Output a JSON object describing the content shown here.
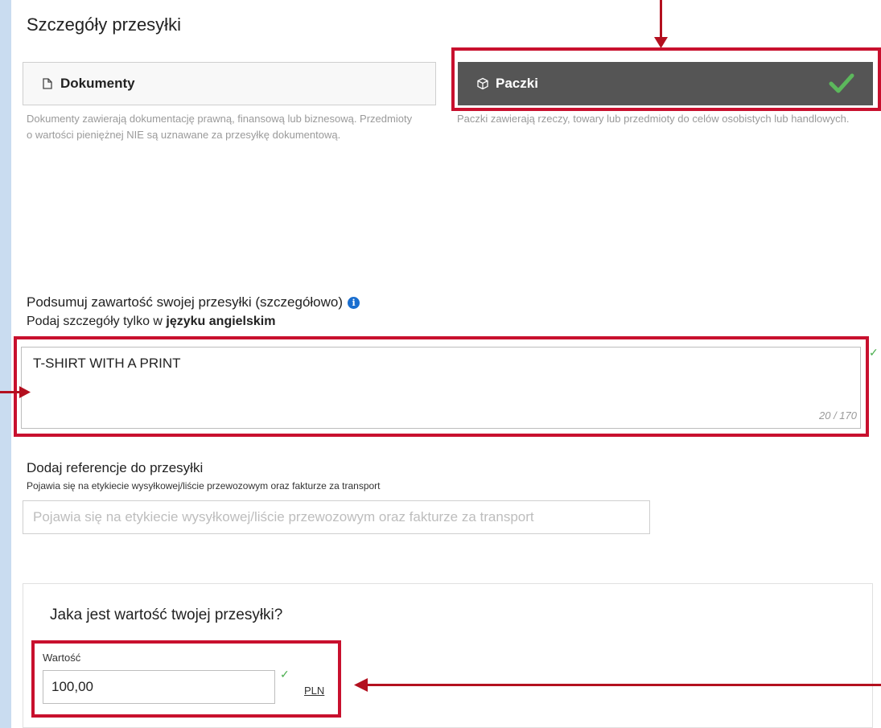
{
  "section": {
    "title": "Szczegóły przesyłki"
  },
  "options": {
    "documents": {
      "label": "Dokumenty",
      "icon": "document-icon",
      "description": "Dokumenty zawierają dokumentację prawną, finansową lub biznesową. Przedmioty o wartości pieniężnej NIE są uznawane za przesyłkę dokumentową."
    },
    "packages": {
      "label": "Paczki",
      "icon": "box-icon",
      "selected": true,
      "description": "Paczki zawierają rzeczy, towary lub przedmioty do celów osobistych lub handlowych."
    }
  },
  "contents": {
    "heading": "Podsumuj zawartość swojej przesyłki (szczegółowo)",
    "info_icon": "i",
    "subtitle_prefix": "Podaj szczegóły tylko w ",
    "subtitle_bold": "języku angielskim",
    "value": "T-SHIRT WITH A PRINT",
    "counter": "20 / 170"
  },
  "reference": {
    "heading": "Dodaj referencje do przesyłki",
    "subtitle": "Pojawia się na etykiecie wysyłkowej/liście przewozowym oraz fakturze za transport",
    "placeholder": "Pojawia się na etykiecie wysyłkowej/liście przewozowym oraz fakturze za transport"
  },
  "value_card": {
    "title": "Jaka jest wartość twojej przesyłki?",
    "field_label": "Wartość",
    "value": "100,00",
    "currency": "PLN"
  },
  "colors": {
    "selected_bg": "#555555",
    "highlight_red": "#c8102e",
    "check_green": "#4caf50",
    "info_blue": "#1a6ecf",
    "side_bg": "#c9dcf0"
  }
}
